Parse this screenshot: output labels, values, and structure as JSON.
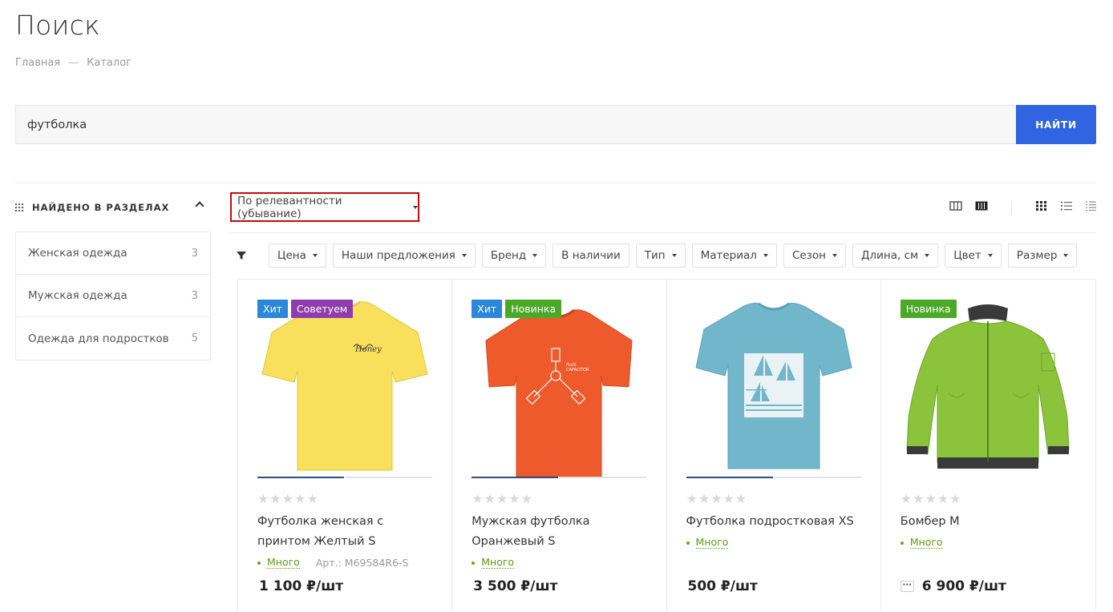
{
  "page": {
    "title": "Поиск"
  },
  "breadcrumb": {
    "items": [
      "Главная",
      "Каталог"
    ],
    "separator": "—"
  },
  "search": {
    "value": "футболка",
    "button_label": "НАЙТИ"
  },
  "sections": {
    "title": "НАЙДЕНО В РАЗДЕЛАХ",
    "items": [
      {
        "label": "Женская одежда",
        "count": "3"
      },
      {
        "label": "Мужская одежда",
        "count": "3"
      },
      {
        "label": "Одежда для подростков",
        "count": "5"
      }
    ]
  },
  "sort": {
    "label": "По релевантности (убывание)"
  },
  "filters": [
    "Цена",
    "Наши предложения",
    "Бренд",
    "В наличии",
    "Тип",
    "Материал",
    "Сезон",
    "Длина, см",
    "Цвет",
    "Размер"
  ],
  "colors": {
    "accent": "#3164e0",
    "hit": "#2c87d8",
    "advise": "#8f3cae",
    "new": "#4ca928",
    "stock": "#5a9b12",
    "highlight": "#c40a0a"
  },
  "products": [
    {
      "badges": [
        {
          "label": "Хит",
          "color": "#2c87d8"
        },
        {
          "label": "Советуем",
          "color": "#8f3cae"
        }
      ],
      "name": "Футболка женская с принтом Желтый S",
      "stock": "Много",
      "sku_label": "Арт.:",
      "sku": "M69584R6-S",
      "price": "1 100 ₽/шт",
      "image": "yellow-tshirt",
      "rating": 0
    },
    {
      "badges": [
        {
          "label": "Хит",
          "color": "#2c87d8"
        },
        {
          "label": "Новинка",
          "color": "#4ca928"
        }
      ],
      "name": "Мужская футболка Оранжевый S",
      "stock": "Много",
      "price": "3 500 ₽/шт",
      "image": "orange-tshirt",
      "rating": 0
    },
    {
      "badges": [],
      "name": "Футболка подростковая XS",
      "stock": "Много",
      "price": "500 ₽/шт",
      "image": "blue-tshirt",
      "rating": 0
    },
    {
      "badges": [
        {
          "label": "Новинка",
          "color": "#4ca928"
        }
      ],
      "name": "Бомбер M",
      "stock": "Много",
      "more": "···",
      "price": "6 900 ₽/шт",
      "image": "green-bomber",
      "rating": 0
    }
  ]
}
